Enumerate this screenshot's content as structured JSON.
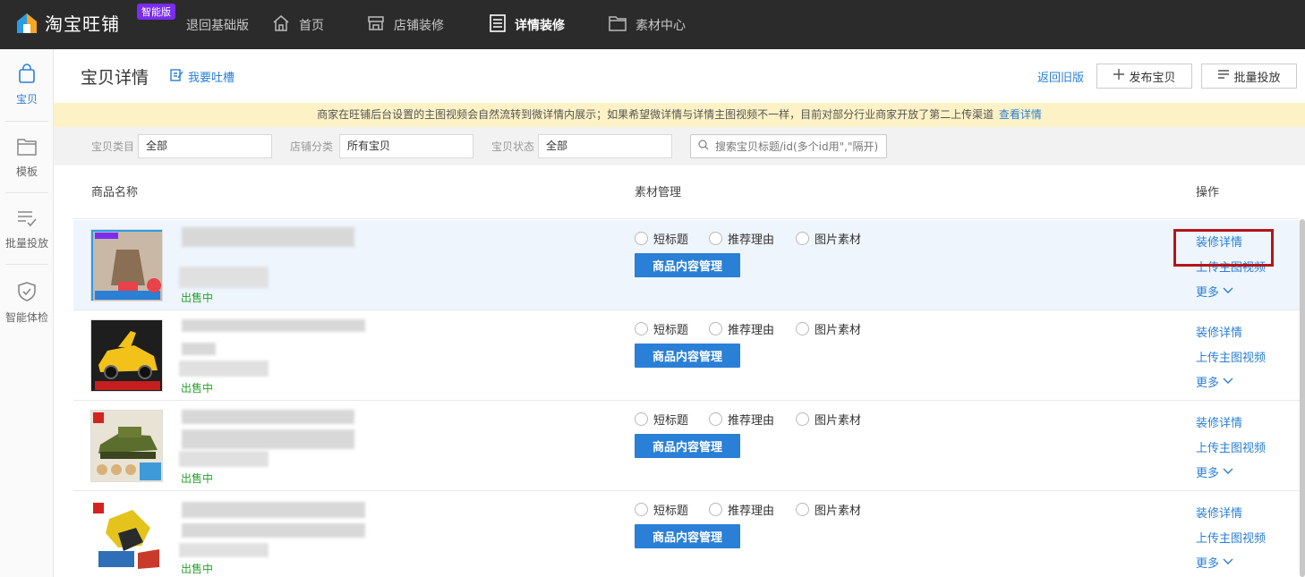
{
  "topbar": {
    "logo_text": "淘宝旺铺",
    "edition_badge": "智能版",
    "nav": [
      {
        "label": "退回基础版"
      },
      {
        "label": "首页"
      },
      {
        "label": "店铺装修"
      },
      {
        "label": "详情装修"
      },
      {
        "label": "素材中心"
      }
    ],
    "active_nav": "详情装修"
  },
  "sidebar": {
    "items": [
      {
        "label": "宝贝",
        "icon": "bag-icon"
      },
      {
        "label": "模板",
        "icon": "folder-icon"
      },
      {
        "label": "批量投放",
        "icon": "list-check-icon"
      },
      {
        "label": "智能体检",
        "icon": "shield-check-icon"
      }
    ],
    "active": "宝贝"
  },
  "header": {
    "title": "宝贝详情",
    "feedback": "我要吐槽",
    "old_version": "返回旧版",
    "publish_button": "发布宝贝",
    "batch_button": "批量投放"
  },
  "notice": {
    "text": "商家在旺铺后台设置的主图视频会自然流转到微详情内展示；如果希望微详情与详情主图视频不一样，目前对部分行业商家开放了第二上传渠道",
    "link": "查看详情"
  },
  "filters": {
    "category_label": "宝贝类目",
    "category_value": "全部",
    "shop_category_label": "店铺分类",
    "shop_category_value": "所有宝贝",
    "status_label": "宝贝状态",
    "status_value": "全部",
    "search_placeholder": "搜索宝贝标题/id(多个id用\",\"隔开)"
  },
  "table": {
    "columns": [
      "商品名称",
      "素材管理",
      "操作"
    ],
    "rows": [
      {
        "status": "出售中",
        "options": [
          "短标题",
          "推荐理由",
          "图片素材"
        ],
        "content_button": "商品内容管理",
        "actions": [
          "装修详情",
          "上传主图视频",
          "更多"
        ]
      },
      {
        "status": "出售中",
        "options": [
          "短标题",
          "推荐理由",
          "图片素材"
        ],
        "content_button": "商品内容管理",
        "actions": [
          "装修详情",
          "上传主图视频",
          "更多"
        ]
      },
      {
        "status": "出售中",
        "options": [
          "短标题",
          "推荐理由",
          "图片素材"
        ],
        "content_button": "商品内容管理",
        "actions": [
          "装修详情",
          "上传主图视频",
          "更多"
        ]
      },
      {
        "status": "出售中",
        "options": [
          "短标题",
          "推荐理由",
          "图片素材"
        ],
        "content_button": "商品内容管理",
        "actions": [
          "装修详情",
          "上传主图视频",
          "更多"
        ]
      }
    ]
  },
  "colors": {
    "accent": "#2a7fd6",
    "topbar": "#2b2b2b",
    "badge": "#7b2cf0",
    "status_green": "#27a02c",
    "notice_bg": "#fdf2c5",
    "highlight_border": "#b3141c"
  }
}
